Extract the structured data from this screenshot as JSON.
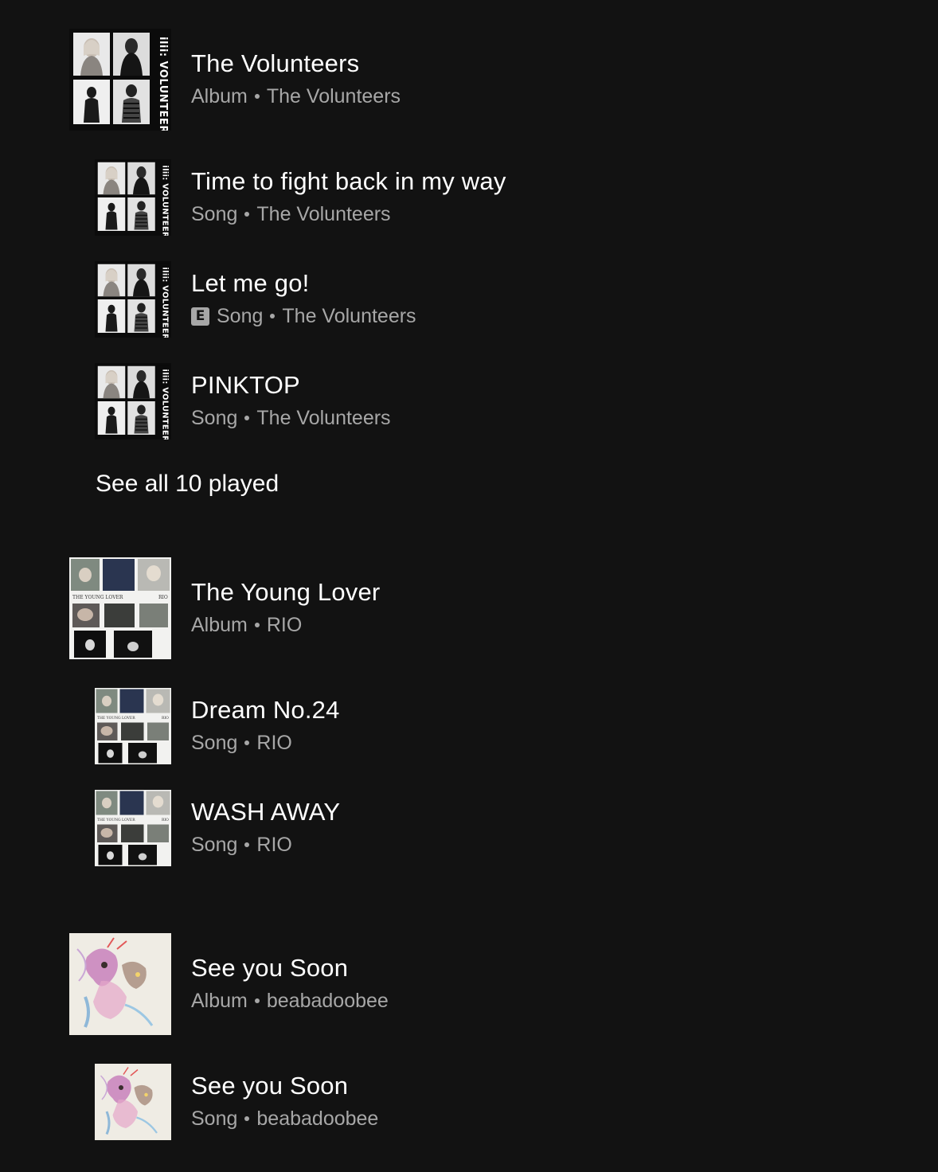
{
  "colors": {
    "background": "#121212",
    "primary_text": "#ffffff",
    "secondary_text": "#a7a7a7"
  },
  "groups": [
    {
      "album": {
        "title": "The Volunteers",
        "type": "Album",
        "artist": "The Volunteers",
        "art": "volunteers-cover-art",
        "art_label": "VOLUNTEERS"
      },
      "songs": [
        {
          "title": "Time to fight back in my way",
          "type": "Song",
          "artist": "The Volunteers",
          "explicit": false
        },
        {
          "title": "Let me go!",
          "type": "Song",
          "artist": "The Volunteers",
          "explicit": true,
          "explicit_label": "E"
        },
        {
          "title": "PINKTOP",
          "type": "Song",
          "artist": "The Volunteers",
          "explicit": false
        }
      ],
      "see_all": "See all 10 played"
    },
    {
      "album": {
        "title": "The Young Lover",
        "type": "Album",
        "artist": "RIO",
        "art": "young-lover-cover-art"
      },
      "songs": [
        {
          "title": "Dream No.24",
          "type": "Song",
          "artist": "RIO",
          "explicit": false
        },
        {
          "title": "WASH AWAY",
          "type": "Song",
          "artist": "RIO",
          "explicit": false
        }
      ]
    },
    {
      "album": {
        "title": "See you Soon",
        "type": "Album",
        "artist": "beabadoobee",
        "art": "see-you-soon-cover-art"
      },
      "songs": [
        {
          "title": "See you Soon",
          "type": "Song",
          "artist": "beabadoobee",
          "explicit": false
        }
      ]
    }
  ]
}
